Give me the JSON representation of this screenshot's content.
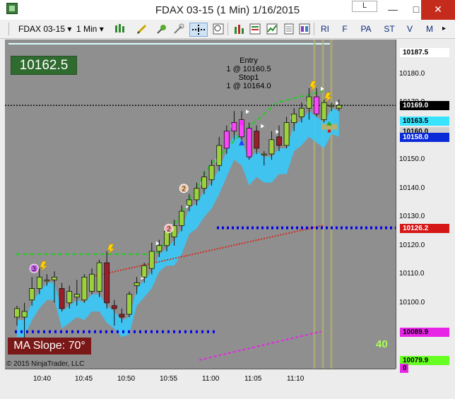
{
  "window": {
    "title": "FDAX 03-15 (1 Min)  1/16/2015",
    "l_label": "L"
  },
  "toolbar": {
    "instrument": "FDAX 03-15",
    "interval": "1 Min",
    "buttons": [
      "RI",
      "F",
      "PA",
      "ST",
      "V",
      "M"
    ]
  },
  "chart": {
    "last_price_box": "10162.5",
    "ma_slope": "MA Slope:  70°",
    "entry_lines": [
      "Entry",
      "1 @ 10160.5",
      "Stop1",
      "1 @ 10164.0"
    ],
    "copyright": "© 2015 NinjaTrader, LLC",
    "counter": "40",
    "marker_labels": [
      "3",
      "2",
      "2"
    ]
  },
  "axis": {
    "y_ticks": [
      "10180.0",
      "10170.0",
      "10160.0",
      "10150.0",
      "10140.0",
      "10130.0",
      "10120.0",
      "10110.0",
      "10100.0",
      "10090.0",
      "10080.0"
    ],
    "y_labels": [
      {
        "text": "10187.5",
        "bg": "#ffffff",
        "fg": "#000000"
      },
      {
        "text": "10169.0",
        "bg": "#000000",
        "fg": "#ffffff"
      },
      {
        "text": "10163.5",
        "bg": "#37e3ff",
        "fg": "#000000"
      },
      {
        "text": "10160.0",
        "bg": "#cfcfcf",
        "fg": "#000000"
      },
      {
        "text": "10158.0",
        "bg": "#0a2ad8",
        "fg": "#ffffff"
      },
      {
        "text": "10126.2",
        "bg": "#d61717",
        "fg": "#ffffff"
      },
      {
        "text": "10089.9",
        "bg": "#e625e6",
        "fg": "#000000"
      },
      {
        "text": "10079.9",
        "bg": "#66ff22",
        "fg": "#000000"
      },
      {
        "text": "0",
        "bg": "#e625e6",
        "fg": "#000000"
      }
    ],
    "x_ticks": [
      "10:40",
      "10:45",
      "10:50",
      "10:55",
      "11:00",
      "11:05",
      "11:10"
    ]
  },
  "colors": {
    "up_candle": "#9bd23c",
    "down_candle": "#9b1f2a",
    "highlight_candle": "#ff44ff",
    "cloud": "#33ccff",
    "dots": "#0000ee",
    "ma_red": "#d8281c"
  },
  "chart_data": {
    "type": "candlestick",
    "symbol": "FDAX 03-15",
    "interval": "1 Min",
    "ylim": [
      10077,
      10192
    ],
    "candles": [
      {
        "o": 10095,
        "h": 10099,
        "l": 10092,
        "c": 10098
      },
      {
        "o": 10095,
        "h": 10100,
        "l": 10087,
        "c": 10097
      },
      {
        "o": 10101,
        "h": 10109,
        "l": 10099,
        "c": 10105
      },
      {
        "o": 10105,
        "h": 10112,
        "l": 10103,
        "c": 10109
      },
      {
        "o": 10108,
        "h": 10110,
        "l": 10106,
        "c": 10108
      },
      {
        "o": 10108,
        "h": 10111,
        "l": 10100,
        "c": 10109
      },
      {
        "o": 10105,
        "h": 10107,
        "l": 10097,
        "c": 10098
      },
      {
        "o": 10100,
        "h": 10106,
        "l": 10098,
        "c": 10104
      },
      {
        "o": 10102,
        "h": 10108,
        "l": 10099,
        "c": 10103
      },
      {
        "o": 10101,
        "h": 10110,
        "l": 10100,
        "c": 10109
      },
      {
        "o": 10104,
        "h": 10112,
        "l": 10103,
        "c": 10110
      },
      {
        "o": 10104,
        "h": 10115,
        "l": 10102,
        "c": 10114
      },
      {
        "o": 10114,
        "h": 10118,
        "l": 10098,
        "c": 10100
      },
      {
        "o": 10099,
        "h": 10101,
        "l": 10092,
        "c": 10098
      },
      {
        "o": 10096,
        "h": 10098,
        "l": 10093,
        "c": 10095
      },
      {
        "o": 10096,
        "h": 10104,
        "l": 10095,
        "c": 10103
      },
      {
        "o": 10106,
        "h": 10109,
        "l": 10103,
        "c": 10107
      },
      {
        "o": 10109,
        "h": 10114,
        "l": 10107,
        "c": 10113
      },
      {
        "o": 10112,
        "h": 10121,
        "l": 10110,
        "c": 10118
      },
      {
        "o": 10118,
        "h": 10122,
        "l": 10116,
        "c": 10120
      },
      {
        "o": 10120,
        "h": 10127,
        "l": 10118,
        "c": 10125
      },
      {
        "o": 10123,
        "h": 10129,
        "l": 10120,
        "c": 10127
      },
      {
        "o": 10127,
        "h": 10134,
        "l": 10125,
        "c": 10132
      },
      {
        "o": 10134,
        "h": 10138,
        "l": 10132,
        "c": 10136
      },
      {
        "o": 10136,
        "h": 10142,
        "l": 10134,
        "c": 10140
      },
      {
        "o": 10140,
        "h": 10146,
        "l": 10138,
        "c": 10144
      },
      {
        "o": 10143,
        "h": 10150,
        "l": 10141,
        "c": 10148
      },
      {
        "o": 10148,
        "h": 10158,
        "l": 10146,
        "c": 10155
      },
      {
        "o": 10154,
        "h": 10162,
        "l": 10152,
        "c": 10160
      },
      {
        "o": 10160,
        "h": 10167,
        "l": 10157,
        "c": 10163
      },
      {
        "o": 10164,
        "h": 10167,
        "l": 10157,
        "c": 10158
      },
      {
        "o": 10161,
        "h": 10163,
        "l": 10150,
        "c": 10151
      },
      {
        "o": 10160,
        "h": 10162,
        "l": 10152,
        "c": 10154
      },
      {
        "o": 10152,
        "h": 10153,
        "l": 10148,
        "c": 10152
      },
      {
        "o": 10152,
        "h": 10160,
        "l": 10150,
        "c": 10157
      },
      {
        "o": 10158,
        "h": 10162,
        "l": 10153,
        "c": 10155
      },
      {
        "o": 10155,
        "h": 10165,
        "l": 10154,
        "c": 10163
      },
      {
        "o": 10163,
        "h": 10168,
        "l": 10160,
        "c": 10166
      },
      {
        "o": 10165,
        "h": 10170,
        "l": 10163,
        "c": 10168
      },
      {
        "o": 10168,
        "h": 10175,
        "l": 10164,
        "c": 10172
      },
      {
        "o": 10172,
        "h": 10175,
        "l": 10165,
        "c": 10166
      },
      {
        "o": 10164,
        "h": 10171,
        "l": 10163,
        "c": 10170
      },
      {
        "o": 10169,
        "h": 10170,
        "l": 10167,
        "c": 10169
      },
      {
        "o": 10168,
        "h": 10171,
        "l": 10167,
        "c": 10169
      }
    ],
    "highlight_indices": [
      28,
      29,
      30,
      31,
      40
    ],
    "horizontal_lines": {
      "last_price": 10169.0,
      "dotted_support": 10126.2,
      "lower_dots": 10089.9,
      "green_dash": 10117.0
    }
  }
}
